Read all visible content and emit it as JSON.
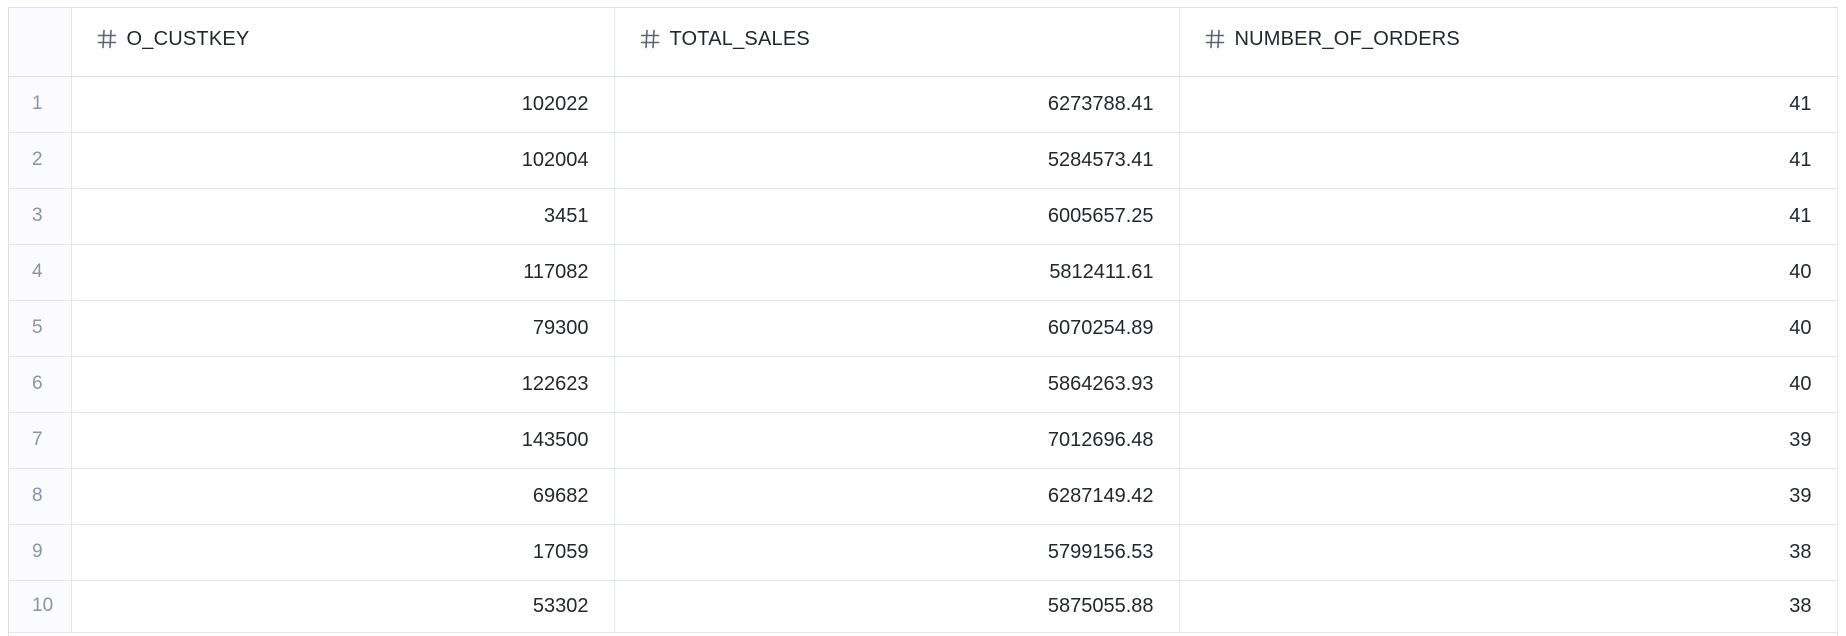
{
  "table": {
    "columns": [
      {
        "label": "O_CUSTKEY",
        "type_icon": "hash-icon"
      },
      {
        "label": "TOTAL_SALES",
        "type_icon": "hash-icon"
      },
      {
        "label": "NUMBER_OF_ORDERS",
        "type_icon": "hash-icon"
      }
    ],
    "rows": [
      {
        "index": "1",
        "o_custkey": "102022",
        "total_sales": "6273788.41",
        "number_of_orders": "41"
      },
      {
        "index": "2",
        "o_custkey": "102004",
        "total_sales": "5284573.41",
        "number_of_orders": "41"
      },
      {
        "index": "3",
        "o_custkey": "3451",
        "total_sales": "6005657.25",
        "number_of_orders": "41"
      },
      {
        "index": "4",
        "o_custkey": "117082",
        "total_sales": "5812411.61",
        "number_of_orders": "40"
      },
      {
        "index": "5",
        "o_custkey": "79300",
        "total_sales": "6070254.89",
        "number_of_orders": "40"
      },
      {
        "index": "6",
        "o_custkey": "122623",
        "total_sales": "5864263.93",
        "number_of_orders": "40"
      },
      {
        "index": "7",
        "o_custkey": "143500",
        "total_sales": "7012696.48",
        "number_of_orders": "39"
      },
      {
        "index": "8",
        "o_custkey": "69682",
        "total_sales": "6287149.42",
        "number_of_orders": "39"
      },
      {
        "index": "9",
        "o_custkey": "17059",
        "total_sales": "5799156.53",
        "number_of_orders": "38"
      },
      {
        "index": "10",
        "o_custkey": "53302",
        "total_sales": "5875055.88",
        "number_of_orders": "38"
      }
    ]
  },
  "colors": {
    "border": "#dcdfe7",
    "index_text": "#8b93aa",
    "icon": "#5b6478"
  }
}
